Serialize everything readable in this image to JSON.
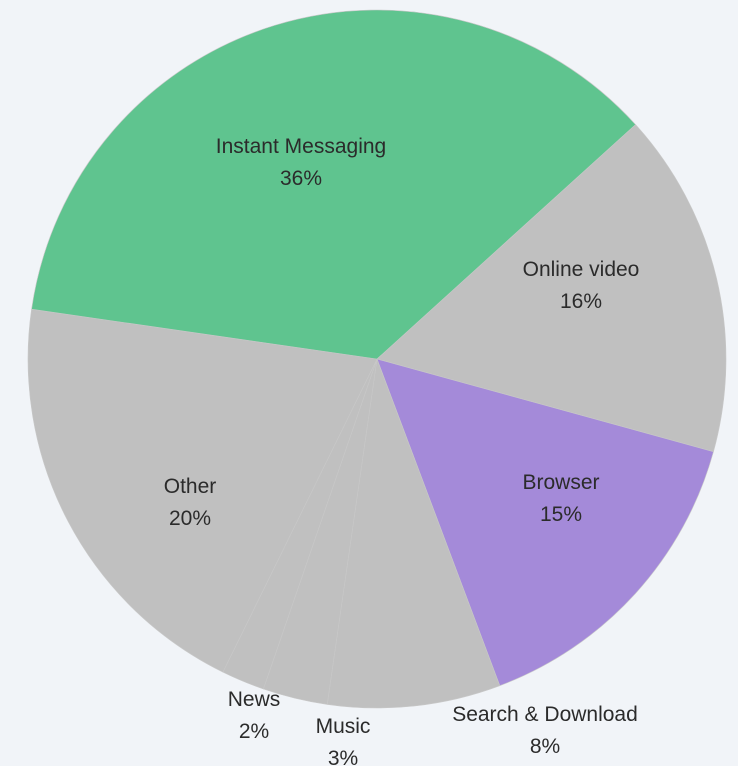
{
  "chart_data": {
    "type": "pie",
    "title": "",
    "slices": [
      {
        "label": "Online video",
        "percent": 16,
        "color": "#c0c0c0"
      },
      {
        "label": "Browser",
        "percent": 15,
        "color": "#a48ad9"
      },
      {
        "label": "Search & Download",
        "percent": 8,
        "color": "#c0c0c0"
      },
      {
        "label": "Music",
        "percent": 3,
        "color": "#c0c0c0"
      },
      {
        "label": "News",
        "percent": 2,
        "color": "#c0c0c0"
      },
      {
        "label": "Other",
        "percent": 20,
        "color": "#c0c0c0"
      },
      {
        "label": "Instant Messaging",
        "percent": 36,
        "color": "#5fc48f"
      }
    ]
  }
}
